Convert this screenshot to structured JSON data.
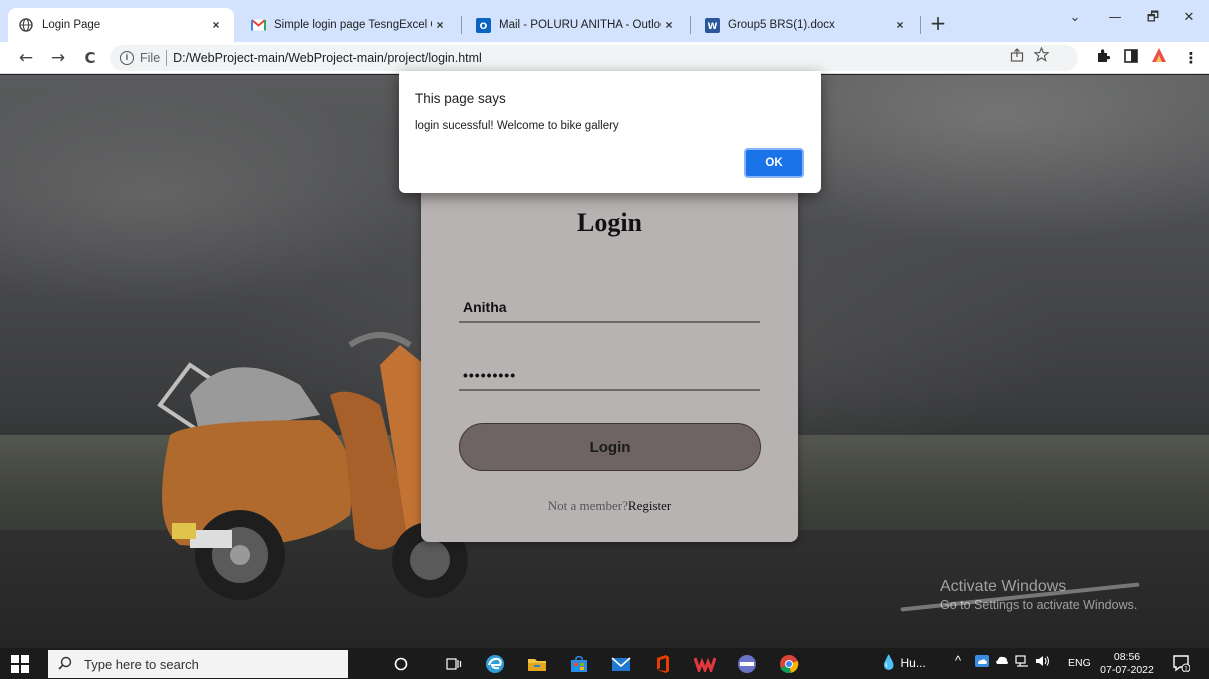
{
  "browser": {
    "tabs": [
      {
        "title": "Login Page",
        "icon": "globe-icon",
        "active": true
      },
      {
        "title": "Simple login page TesngExcel Co",
        "icon": "gmail-icon"
      },
      {
        "title": "Mail - POLURU ANITHA - Outloo",
        "icon": "outlook-icon"
      },
      {
        "title": "Group5 BRS(1).docx",
        "icon": "word-icon"
      }
    ],
    "tab_close": "×",
    "new_tab": "+",
    "window_controls": {
      "chevron": "⌄",
      "minimize": "—",
      "restore": "🗗",
      "close": "✕"
    },
    "nav": {
      "back": "←",
      "forward": "→",
      "reload": "C"
    },
    "address": {
      "info_glyph": "i",
      "scheme": "File",
      "url": "D:/WebProject-main/WebProject-main/project/login.html"
    }
  },
  "page": {
    "login": {
      "title": "Login",
      "username_value": "Anitha",
      "password_value": "•••••••••",
      "button_label": "Login",
      "not_member_text": "Not a member?",
      "register_link": "Register"
    },
    "watermark": {
      "line1": "Activate Windows",
      "line2": "Go to Settings to activate Windows."
    }
  },
  "dialog": {
    "title": "This page says",
    "message": "login sucessful! Welcome to bike gallery",
    "ok_label": "OK"
  },
  "taskbar": {
    "search_placeholder": "Type here to search",
    "tray_weather": "Hu...",
    "tray_lang": "ENG",
    "time": "08:56",
    "date": "07-07-2022"
  },
  "colors": {
    "tabstrip": "#d3e3fd",
    "card": "#b8b3b3",
    "login_button": "#6e6464",
    "ok_button": "#1a73e8",
    "taskbar": "#1b1b1b"
  }
}
